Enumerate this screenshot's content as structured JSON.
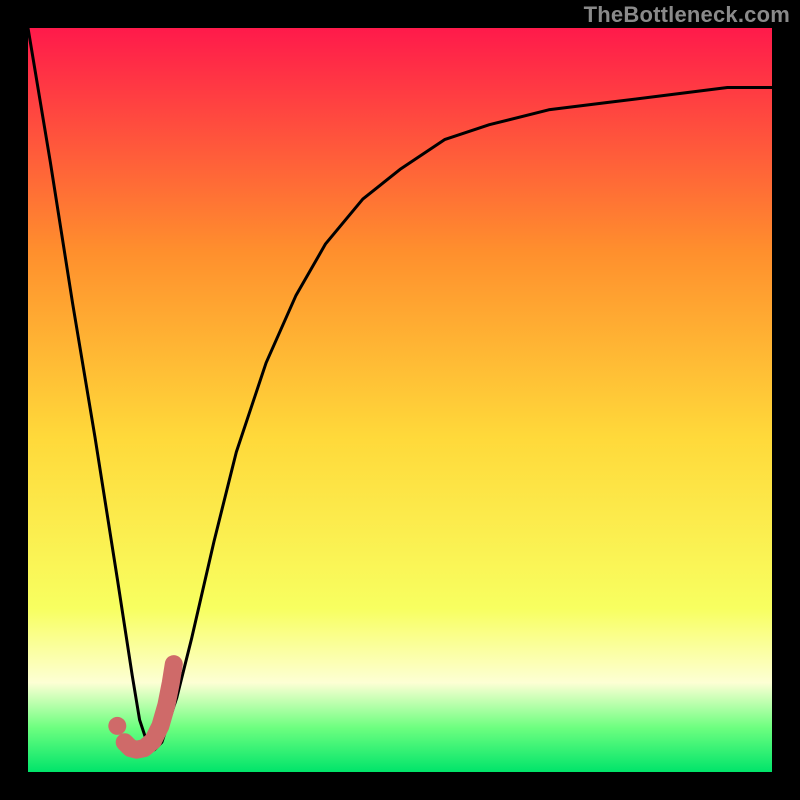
{
  "watermark": "TheBottleneck.com",
  "chart_data": {
    "type": "line",
    "title": "",
    "xlabel": "",
    "ylabel": "",
    "xlim": [
      0,
      100
    ],
    "ylim": [
      0,
      100
    ],
    "grid": false,
    "legend": false,
    "gradient_colors": {
      "top": "#ff1a4b",
      "upper_mid": "#ff8f2d",
      "mid": "#ffd93a",
      "lower_mid": "#f8ff60",
      "whitish": "#fdffd4",
      "green_light": "#6eff80",
      "green": "#00e46a"
    },
    "series": [
      {
        "name": "bottleneck-curve",
        "type": "line",
        "color": "#000000",
        "x": [
          0,
          3,
          6,
          9,
          12,
          14,
          15,
          16,
          17,
          18,
          20,
          22,
          25,
          28,
          32,
          36,
          40,
          45,
          50,
          56,
          62,
          70,
          78,
          86,
          94,
          100
        ],
        "y": [
          100,
          82,
          63,
          45,
          26,
          13,
          7,
          4,
          3,
          4,
          10,
          18,
          31,
          43,
          55,
          64,
          71,
          77,
          81,
          85,
          87,
          89,
          90,
          91,
          92,
          92
        ]
      },
      {
        "name": "marker-j-shape",
        "type": "line",
        "color": "#cf6a69",
        "x": [
          13.0,
          13.8,
          14.6,
          15.6,
          16.8,
          17.8,
          18.6,
          19.2,
          19.6
        ],
        "y": [
          4.0,
          3.2,
          3.0,
          3.2,
          4.2,
          6.2,
          9.0,
          12.0,
          14.5
        ]
      },
      {
        "name": "marker-dot",
        "type": "scatter",
        "color": "#cf6a69",
        "x": [
          12.0
        ],
        "y": [
          6.2
        ]
      }
    ]
  }
}
